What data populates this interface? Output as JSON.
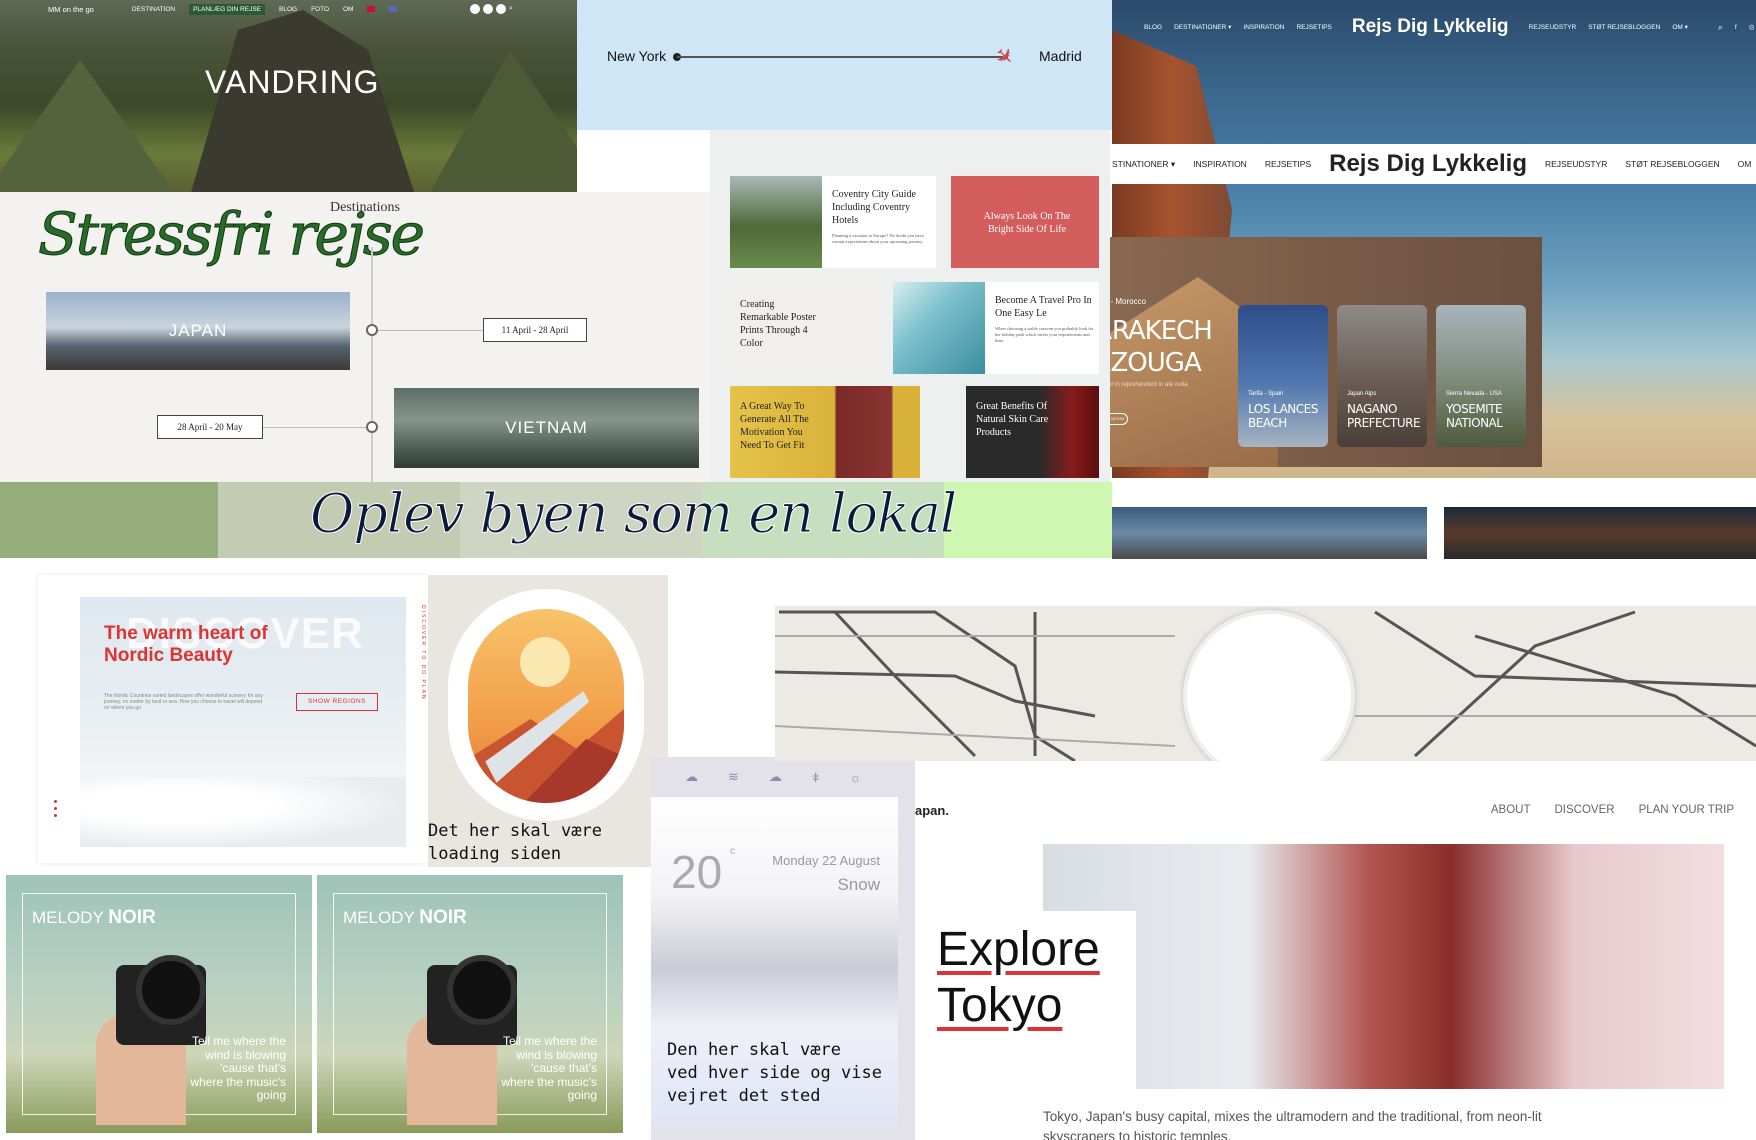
{
  "hiking": {
    "brand": "MM on the go",
    "nav": [
      "DESTINATION",
      "PLANLÆG DIN REJSE",
      "BLOG",
      "FOTO",
      "OM"
    ],
    "title": "VANDRING"
  },
  "flight": {
    "from": "New York",
    "to": "Madrid"
  },
  "rejs": {
    "nav_top_left": [
      "BLOG",
      "DESTINATIONER ▾",
      "INSPIRATION",
      "REJSETIPS"
    ],
    "logo": "Rejs Dig Lykkelig",
    "nav_top_right": [
      "REJSEUDSTYR",
      "STØT REJSEBLOGGEN",
      "OM ▾"
    ],
    "nav2_left": [
      "STINATIONER ▾",
      "INSPIRATION",
      "REJSETIPS"
    ],
    "nav2_right": [
      "REJSEUDSTYR",
      "STØT REJSEBLOGGEN",
      "OM"
    ]
  },
  "morocco": {
    "sub": "a Desert - Morocco",
    "title_line1": "ARRAKECH",
    "title_line2": "ERZOUGA",
    "desc": "de nure dolor in reprehenderit in ate nulla pariatur",
    "button": "DISCOVER LOCATION",
    "cards": [
      {
        "sub": "Tarifa - Spain",
        "name": "LOS LANCES BEACH"
      },
      {
        "sub": "Japan Alps",
        "name": "NAGANO PREFECTURE"
      },
      {
        "sub": "Sierra Nevada - USA",
        "name": "YOSEMITE NATIONAL"
      }
    ]
  },
  "destinations": {
    "heading": "Destinations",
    "script": "Stressfri rejse",
    "items": [
      {
        "name": "JAPAN",
        "dates": "11 April - 28 April"
      },
      {
        "name": "VIETNAM",
        "dates": "28 April - 20 May"
      }
    ]
  },
  "blog": {
    "cards": [
      {
        "title": "Coventry City Guide Including Coventry Hotels",
        "excerpt": "Planning a vacation to Europe? No doubt you have certain expectations about your upcoming journey."
      },
      {
        "title": "Always Look On The Bright Side Of Life"
      },
      {
        "title": "Creating Remarkable Poster Prints Through 4 Color"
      },
      {
        "title": "Become A Travel Pro In One Easy Le",
        "excerpt": "When choosing a stable caravan you probably look for the holiday park which meets your requirements and then."
      },
      {
        "title": "A Great Way To Generate All The Motivation You Need To Get Fit"
      },
      {
        "title": "Great Benefits Of Natural Skin Care Products"
      }
    ]
  },
  "oplev": {
    "text": "Oplev byen som en lokal",
    "colors": [
      "#95ae7c",
      "#c3cbb2",
      "#cfd5c3",
      "#c6dfbf",
      "#cef7b1"
    ]
  },
  "discover": {
    "big": "DISCOVER",
    "heading_line1": "The warm heart of",
    "heading_line2": "Nordic Beauty",
    "para": "The Nordic Countries varied landscapes offer wonderful scenery for any journey, no matter by land or sea. How you choose to travel will depend on where you go.",
    "button": "SHOW REGIONS",
    "side": "DISCOVER TO DO PLAN"
  },
  "window": {
    "caption_line1": "Det her skal være",
    "caption_line2": "loading siden"
  },
  "melody": {
    "title_light": "MELODY",
    "title_bold": "NOIR",
    "quote": "Tell me where the wind is blowing 'cause that's where the music's going"
  },
  "weather": {
    "temp": "20",
    "unit": "c",
    "date": "Monday 22 August",
    "condition": "Snow",
    "caption_line1": "Den her skal være",
    "caption_line2": "ved hver side og vise",
    "caption_line3": "vejret det sted"
  },
  "tokyo": {
    "brand": "apan.",
    "nav": [
      "ABOUT",
      "DISCOVER",
      "PLAN YOUR TRIP"
    ],
    "title_line1": "Explore",
    "title_line2": "Tokyo",
    "para": "Tokyo, Japan's busy capital, mixes the ultramodern and the traditional, from neon-lit skyscrapers to historic temples."
  },
  "colors": {
    "accent_red": "#d33333",
    "script_green": "#2a6a2a",
    "hike_active": "#2d5a36"
  }
}
